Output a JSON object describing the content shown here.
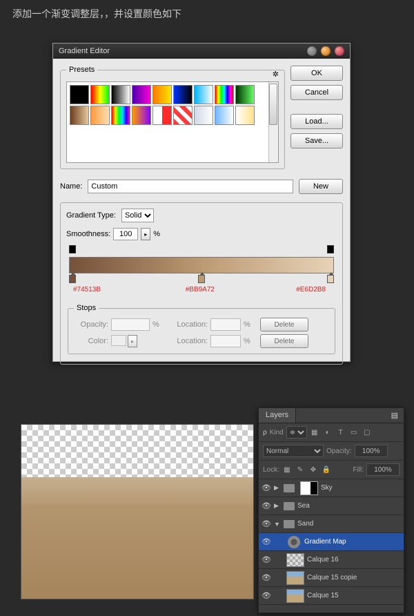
{
  "instruction": "添加一个渐变调整层，，并设置颜色如下",
  "dialog": {
    "title": "Gradient Editor",
    "buttons": {
      "ok": "OK",
      "cancel": "Cancel",
      "load": "Load...",
      "save": "Save...",
      "new": "New"
    },
    "presets_label": "Presets",
    "swatches": [
      "linear-gradient(to right,#000,#000)",
      "linear-gradient(to right,#ff0000,#ffff00,#00ff00)",
      "linear-gradient(to right,#000,#fff)",
      "linear-gradient(to right,#4a00b0,#ff00d4)",
      "linear-gradient(to right,#ff7a00,#ffe600)",
      "linear-gradient(to right,#0033ff,#000)",
      "linear-gradient(to right,#00b3ff,#fff)",
      "linear-gradient(to right,#ff0000,#ffff00,#00ff00,#00ffff,#0000ff,#ff00ff,#ff0000)",
      "linear-gradient(to right,#003300,#66ff66)",
      "linear-gradient(to right,#6b3e1f,#e6c79c)",
      "linear-gradient(to right,#ff9a3c,#ffe0b3)",
      "linear-gradient(to right,#ff0000,#ffee00,#00ff22,#00e0ff,#2b00ff,#ff00c8)",
      "linear-gradient(to right,#ff9a00,#8800ff)",
      "linear-gradient(to right,#ffffff 0,#ffffff 50%,#ff2a2a 50%,#ff2a2a 100%)",
      "repeating-linear-gradient(45deg,#ff3a3a 0 6px,#fff 6px 12px)",
      "linear-gradient(to right,#cfd9e6,#fff)",
      "linear-gradient(to right,#6fb7ff,#fff)",
      "linear-gradient(to right,#fff,#ffe28a)"
    ],
    "name_label": "Name:",
    "name_value": "Custom",
    "gtype_label": "Gradient Type:",
    "gtype_value": "Solid",
    "smooth_label": "Smoothness:",
    "smooth_value": "100",
    "percent": "%",
    "gradient_stops": {
      "left": {
        "hex": "#74513B",
        "pos": 0
      },
      "mid": {
        "hex": "#BB9A72",
        "pos": 50
      },
      "right": {
        "hex": "#E6D2B8",
        "pos": 100
      }
    },
    "stops_label": "Stops",
    "opacity_label": "Opacity:",
    "location_label": "Location:",
    "color_label": "Color:",
    "delete_label": "Delete"
  },
  "layers": {
    "tab": "Layers",
    "kind_label": "Kind",
    "kind_icons": [
      "▦",
      "◐",
      "T",
      "▭",
      "▢"
    ],
    "blend_mode": "Normal",
    "opacity_label": "Opacity:",
    "opacity_value": "100%",
    "lock_label": "Lock:",
    "lock_icons": [
      "▦",
      "✎",
      "✥",
      "🔒"
    ],
    "fill_label": "Fill:",
    "fill_value": "100%",
    "items": [
      {
        "type": "group",
        "name": "Sky",
        "open": false,
        "mask": true
      },
      {
        "type": "group",
        "name": "Sea",
        "open": false,
        "mask": false
      },
      {
        "type": "group",
        "name": "Sand",
        "open": true,
        "mask": false
      },
      {
        "type": "adj",
        "name": "Gradient Map",
        "selected": true,
        "indent": 1
      },
      {
        "type": "layer",
        "name": "Calque 16",
        "thumb": "checker",
        "indent": 1
      },
      {
        "type": "layer",
        "name": "Calque 15 copie",
        "thumb": "photo",
        "indent": 1
      },
      {
        "type": "layer",
        "name": "Calque 15",
        "thumb": "photo",
        "indent": 1
      }
    ]
  }
}
